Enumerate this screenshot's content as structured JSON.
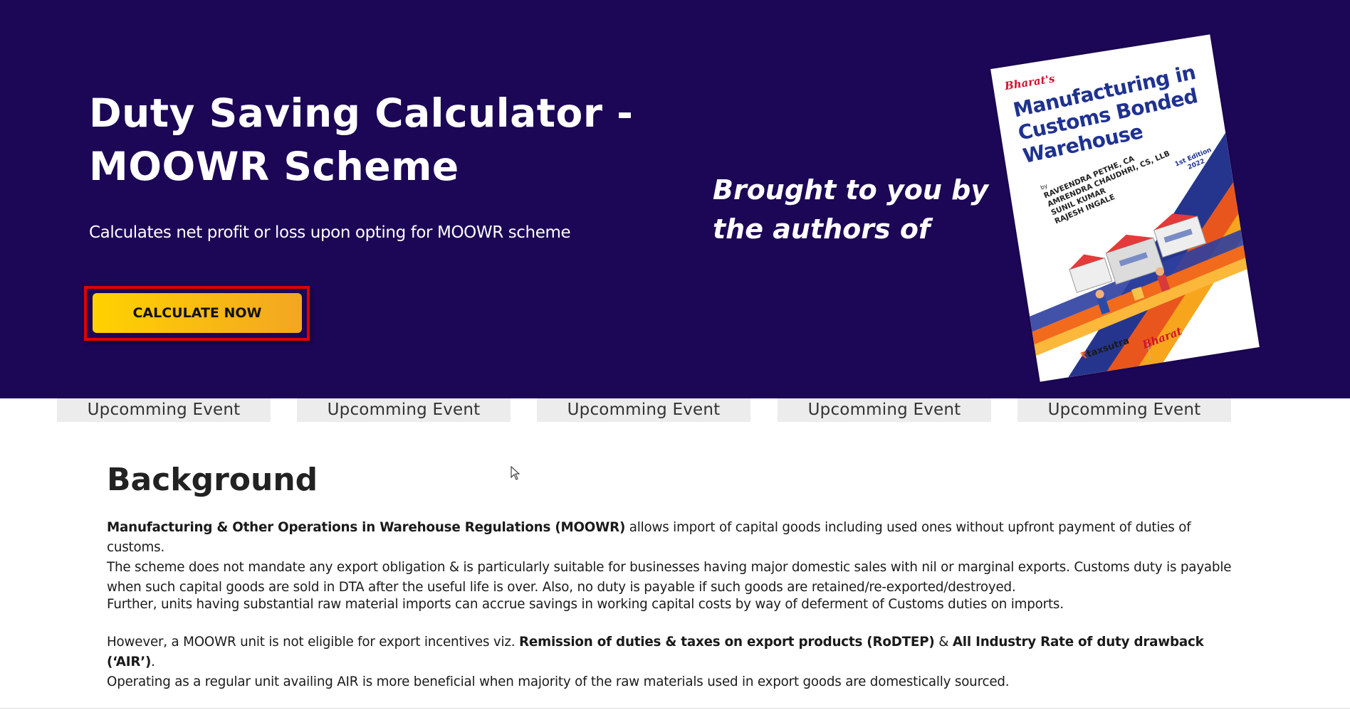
{
  "hero": {
    "title_line1": "Duty Saving Calculator -",
    "title_line2": "MOOWR Scheme",
    "subtitle": "Calculates net profit or loss upon opting for MOOWR scheme",
    "cta_label": "CALCULATE NOW",
    "brought_line1": "Brought to you by",
    "brought_line2": "the authors of"
  },
  "book": {
    "brand": "Bharat's",
    "title_line1": "Manufacturing in",
    "title_line2": "Customs Bonded",
    "title_line3": "Warehouse",
    "by": "by",
    "authors": [
      "RAVEENDRA PETHE, CA",
      "AMRENDRA CHAUDHRI, CS, LLB",
      "SUNIL KUMAR",
      "RAJESH INGALE"
    ],
    "edition_line1": "1st Edition",
    "edition_line2": "2022",
    "logo1": "taxsutra",
    "logo2": "Bharat"
  },
  "tabs": [
    {
      "label": "Upcomming Event"
    },
    {
      "label": "Upcomming Event"
    },
    {
      "label": "Upcomming Event"
    },
    {
      "label": "Upcomming Event"
    },
    {
      "label": "Upcomming Event"
    }
  ],
  "background": {
    "heading": "Background",
    "p1_bold": "Manufacturing & Other Operations in Warehouse Regulations (MOOWR)",
    "p1_rest_line1": " allows import of capital goods including used ones without upfront payment of duties of customs.",
    "p1_line2": "The scheme does not mandate any export obligation & is particularly suitable for businesses having major domestic sales with nil or marginal exports. Customs duty is payable",
    "p1_line3": "when such capital goods are sold in DTA after the useful life is over. Also, no duty is payable if such goods are retained/re-exported/destroyed.",
    "p2": "Further, units having substantial raw material imports can accrue savings in working capital costs by way of deferment of Customs duties on imports.",
    "p3_start": "However, a MOOWR unit is not eligible for export incentives viz. ",
    "p3_bold1": "Remission of duties & taxes on export products (RoDTEP)",
    "p3_amp": " & ",
    "p3_bold2": "All Industry Rate of duty drawback (‘AIR’)",
    "p3_end": ".",
    "p3_line2": "Operating as a regular unit availing AIR is more beneficial when majority of the raw materials used in export goods are domestically sourced."
  },
  "colors": {
    "hero_bg": "#1c0656",
    "cta_start": "#ffd200",
    "cta_end": "#f3a622",
    "cta_outline": "#e00000",
    "tab_bg": "#ececec"
  }
}
